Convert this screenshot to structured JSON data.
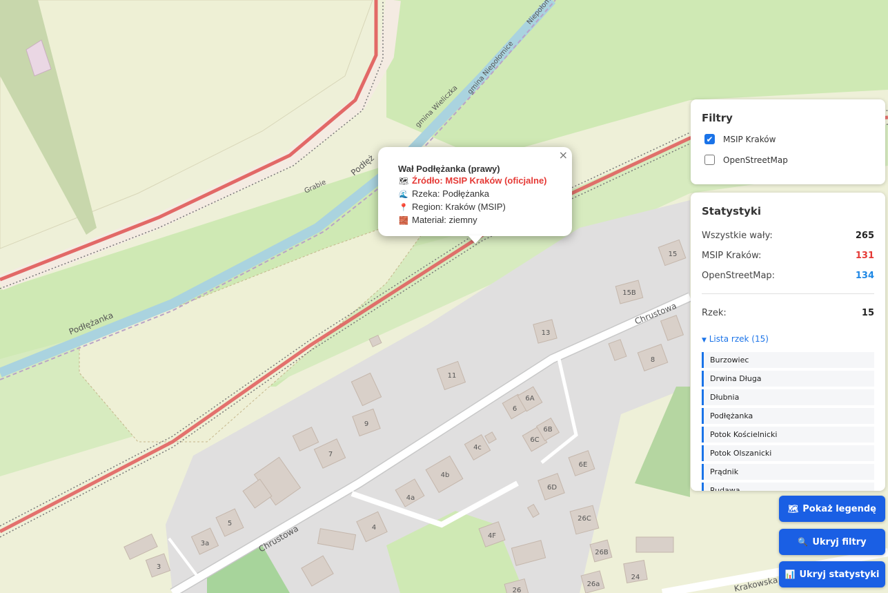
{
  "popup": {
    "title": "Wał Podłężanka (prawy)",
    "source": "Źródło: MSIP Kraków (oficjalne)",
    "river": "Rzeka: Podłężanka",
    "region": "Region: Kraków (MSIP)",
    "material": "Materiał: ziemny",
    "close": "×",
    "icons": [
      "map-icon",
      "wave-icon",
      "pin-icon",
      "brick-icon"
    ]
  },
  "filters": {
    "title": "Filtry",
    "items": [
      {
        "label": "MSIP Kraków",
        "checked": true
      },
      {
        "label": "OpenStreetMap",
        "checked": false
      }
    ]
  },
  "stats": {
    "title": "Statystyki",
    "all_label": "Wszystkie wały:",
    "all_value": "265",
    "msip_label": "MSIP Kraków:",
    "msip_value": "131",
    "osm_label": "OpenStreetMap:",
    "osm_value": "134",
    "rivers_label": "Rzek:",
    "rivers_value": "15",
    "list_toggle": "Lista rzek (15)",
    "rivers": [
      "Burzowiec",
      "Drwina Długa",
      "Dłubnia",
      "Podłężanka",
      "Potok Kościelnicki",
      "Potok Olszanicki",
      "Prądnik",
      "Rudawa"
    ],
    "colors": {
      "msip": "#e53935",
      "osm": "#1e88e5"
    }
  },
  "buttons": {
    "legend": "Pokaż legendę",
    "filters": "Ukryj filtry",
    "stats": "Ukryj statystyki"
  },
  "map_labels": {
    "street_1": "Chrustowa",
    "street_2": "Chrustowa",
    "street_3": "Krakowska",
    "stream_1": "Podłężanka",
    "stream_2": "Podłęż",
    "stream_3": "Niepołom",
    "boundary_1": "gmina Wieliczka",
    "boundary_2": "gmina Niepołomice",
    "place": "Grabie",
    "house_numbers": [
      "15",
      "15B",
      "13",
      "8",
      "11",
      "9",
      "6A",
      "6",
      "6B",
      "6C",
      "4c",
      "7",
      "4b",
      "6E",
      "6D",
      "4a",
      "5",
      "3a",
      "4",
      "26C",
      "4F",
      "26B",
      "3",
      "24",
      "26a",
      "26"
    ]
  }
}
